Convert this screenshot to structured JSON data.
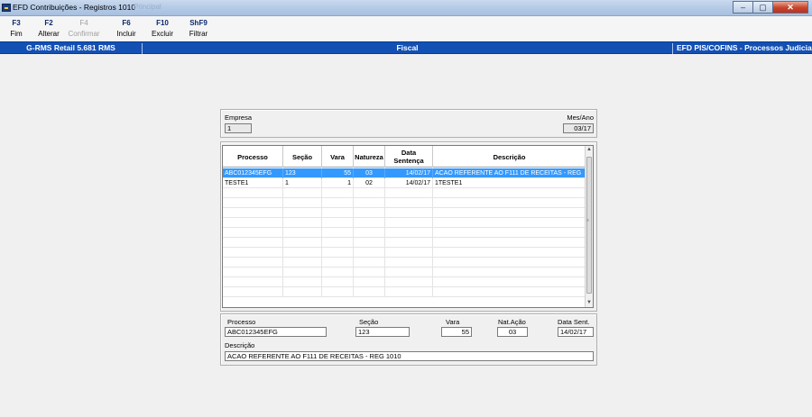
{
  "window": {
    "title": "EFD Contribuições - Registros 1010",
    "ghost_text": "Principal",
    "minimize": "–",
    "maximize": "▢",
    "close": "✕"
  },
  "toolbar": [
    {
      "key": "F3",
      "label": "Fim",
      "enabled": true
    },
    {
      "key": "F2",
      "label": "Alterar",
      "enabled": true
    },
    {
      "key": "F4",
      "label": "Confirmar",
      "enabled": false
    },
    {
      "key": "F6",
      "label": "Incluir",
      "enabled": true
    },
    {
      "key": "F10",
      "label": "Excluir",
      "enabled": true
    },
    {
      "key": "ShF9",
      "label": "Filtrar",
      "enabled": true
    }
  ],
  "header": {
    "system": "G-RMS Retail 5.681 RMS",
    "module": "Fiscal",
    "screen": "EFD PIS/COFINS - Processos Judicia"
  },
  "filter": {
    "empresa_label": "Empresa",
    "empresa_value": "1",
    "mesano_label": "Mes/Ano",
    "mesano_value": "03/17"
  },
  "grid": {
    "columns": [
      "Processo",
      "Seção",
      "Vara",
      "Natureza",
      "Data Sentença",
      "Descrição"
    ],
    "rows": [
      {
        "processo": "ABC012345EFG",
        "secao": "123",
        "vara": "55",
        "natureza": "03",
        "data": "14/02/17",
        "descricao": "ACAO REFERENTE AO F111 DE RECEITAS - REG",
        "selected": true
      },
      {
        "processo": "TESTE1",
        "secao": "1",
        "vara": "1",
        "natureza": "02",
        "data": "14/02/17",
        "descricao": "1TESTE1",
        "selected": false
      }
    ],
    "empty_rows": 11
  },
  "detail": {
    "processo_label": "Processo",
    "processo_value": "ABC012345EFG",
    "secao_label": "Seção",
    "secao_value": "123",
    "vara_label": "Vara",
    "vara_value": "55",
    "natacao_label": "Nat.Ação",
    "natacao_value": "03",
    "datasent_label": "Data Sent.",
    "datasent_value": "14/02/17",
    "descricao_label": "Descrição",
    "descricao_value": "ACAO REFERENTE AO F111 DE RECEITAS - REG 1010"
  }
}
